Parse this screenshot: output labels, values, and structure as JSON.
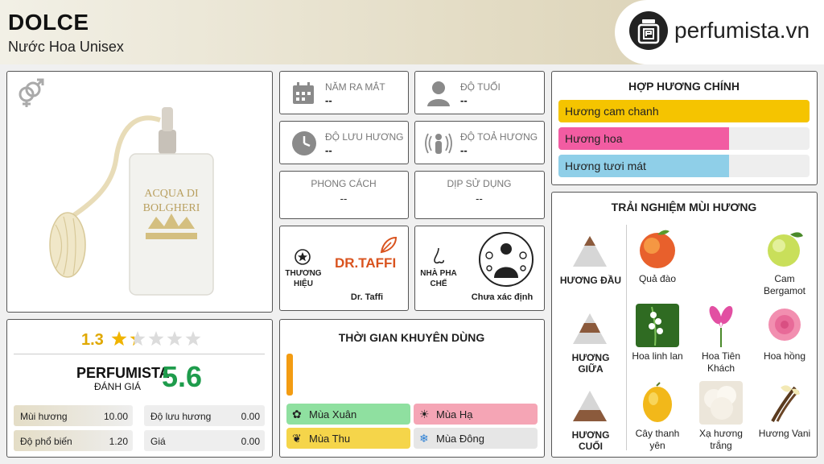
{
  "header": {
    "title": "DOLCE",
    "subtitle": "Nước Hoa Unisex",
    "brand": "perfumista.vn"
  },
  "info_cells": {
    "release_label": "NĂM RA MẮT",
    "release_value": "--",
    "age_label": "ĐỘ TUỔI",
    "age_value": "--",
    "longevity_label": "ĐỘ LƯU HƯƠNG",
    "longevity_value": "--",
    "sillage_label": "ĐỘ TOẢ HƯƠNG",
    "sillage_value": "--",
    "style_label": "PHONG CÁCH",
    "style_value": "--",
    "occasion_label": "DỊP SỬ DỤNG",
    "occasion_value": "--"
  },
  "brand_card": {
    "label": "THƯƠNG HIỆU",
    "logo_text": "DR.TAFFI",
    "name": "Dr. Taffi"
  },
  "perfumer_card": {
    "label": "NHÀ PHA CHẾ",
    "name": "Chưa xác định"
  },
  "product_image": {
    "bottle_text_1": "ACQUA DI",
    "bottle_text_2": "BOLGHERI"
  },
  "main_accords": {
    "title": "HỢP HƯƠNG CHÍNH",
    "items": [
      {
        "label": "Hương cam chanh",
        "color": "#f5c400",
        "fraction": 1.0
      },
      {
        "label": "Hương hoa",
        "color": "#f25ca2",
        "fraction": 0.68
      },
      {
        "label": "Hương tươi mát",
        "color": "#8fcfe8",
        "fraction": 0.68
      }
    ]
  },
  "scent_experience": {
    "title": "TRẢI NGHIỆM MÙI HƯƠNG",
    "tiers": [
      {
        "label": "HƯƠNG ĐẦU",
        "notes": [
          "Quả đào",
          "Cam Bergamot"
        ]
      },
      {
        "label": "HƯƠNG GIỮA",
        "notes": [
          "Hoa linh lan",
          "Hoa Tiên Khách",
          "Hoa hồng"
        ]
      },
      {
        "label": "HƯƠNG CUỐI",
        "notes": [
          "Cây thanh yên",
          "Xạ hương trắng",
          "Hương Vani"
        ]
      }
    ]
  },
  "rating": {
    "user_score": "1.3",
    "stars_filled": 1.3,
    "perfumista_label": "PERFUMISTA",
    "perfumista_sublabel": "ĐÁNH GIÁ",
    "perfumista_score": "5.6",
    "stats": [
      {
        "label": "Mùi hương",
        "value": "10.00"
      },
      {
        "label": "Độ lưu hương",
        "value": "0.00"
      },
      {
        "label": "Độ phổ biến",
        "value": "1.20"
      },
      {
        "label": "Giá",
        "value": "0.00"
      }
    ]
  },
  "recommended_time": {
    "title": "THỜI GIAN KHUYÊN DÙNG",
    "seasons": [
      {
        "label": "Mùa Xuân",
        "color": "#8fe0a0"
      },
      {
        "label": "Mùa Hạ",
        "color": "#f5a5b5"
      },
      {
        "label": "Mùa Thu",
        "color": "#f5d54a"
      },
      {
        "label": "Mùa Đông",
        "color": "#e6e6e6"
      }
    ]
  }
}
